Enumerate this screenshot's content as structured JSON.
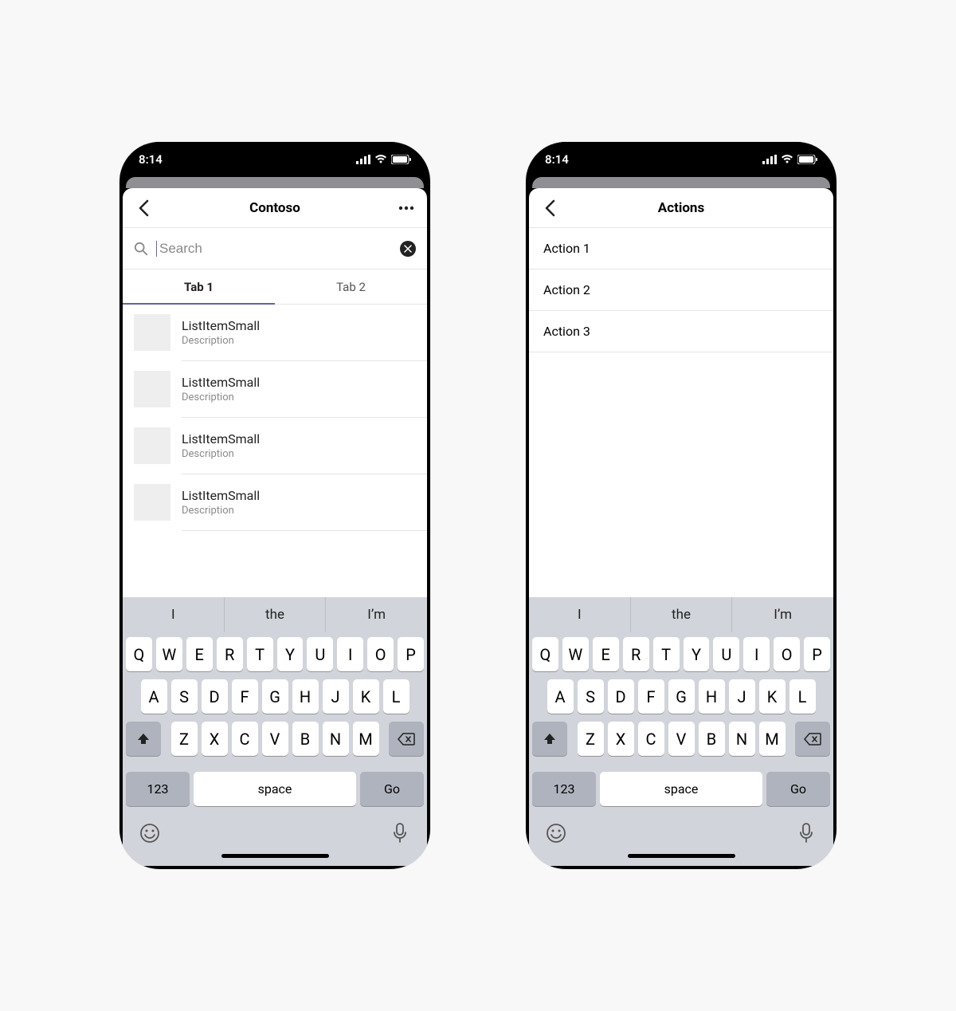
{
  "status": {
    "time": "8:14"
  },
  "screen1": {
    "title": "Contoso",
    "search_placeholder": "Search",
    "tabs": [
      {
        "label": "Tab 1",
        "active": true
      },
      {
        "label": "Tab 2",
        "active": false
      }
    ],
    "items": [
      {
        "title": "ListItemSmall",
        "desc": "Description"
      },
      {
        "title": "ListItemSmall",
        "desc": "Description"
      },
      {
        "title": "ListItemSmall",
        "desc": "Description"
      },
      {
        "title": "ListItemSmall",
        "desc": "Description"
      }
    ]
  },
  "screen2": {
    "title": "Actions",
    "actions": [
      {
        "label": "Action 1"
      },
      {
        "label": "Action 2"
      },
      {
        "label": "Action 3"
      }
    ]
  },
  "keyboard": {
    "suggestions": [
      "I",
      "the",
      "I’m"
    ],
    "rows": [
      [
        "Q",
        "W",
        "E",
        "R",
        "T",
        "Y",
        "U",
        "I",
        "O",
        "P"
      ],
      [
        "A",
        "S",
        "D",
        "F",
        "G",
        "H",
        "J",
        "K",
        "L"
      ],
      [
        "Z",
        "X",
        "C",
        "V",
        "B",
        "N",
        "M"
      ]
    ],
    "numeric_label": "123",
    "space_label": "space",
    "go_label": "Go"
  }
}
